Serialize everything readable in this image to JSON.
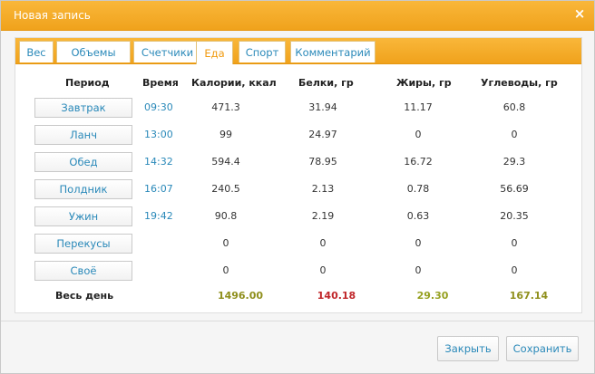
{
  "dialog": {
    "title": "Новая запись",
    "close_icon": "×"
  },
  "tabs": [
    {
      "label": "Вес",
      "active": false
    },
    {
      "label": "Объемы",
      "active": false
    },
    {
      "label": "Счетчики",
      "active": false
    },
    {
      "label": "Еда",
      "active": true
    },
    {
      "label": "Спорт",
      "active": false
    },
    {
      "label": "Комментарий",
      "active": false
    }
  ],
  "table": {
    "headers": [
      "Период",
      "Время",
      "Калории, ккал",
      "Белки, гр",
      "Жиры, гр",
      "Углеводы, гр"
    ],
    "rows": [
      {
        "period": "Завтрак",
        "time": "09:30",
        "calories": "471.3",
        "protein": "31.94",
        "fat": "11.17",
        "carbs": "60.8"
      },
      {
        "period": "Ланч",
        "time": "13:00",
        "calories": "99",
        "protein": "24.97",
        "fat": "0",
        "carbs": "0"
      },
      {
        "period": "Обед",
        "time": "14:32",
        "calories": "594.4",
        "protein": "78.95",
        "fat": "16.72",
        "carbs": "29.3"
      },
      {
        "period": "Полдник",
        "time": "16:07",
        "calories": "240.5",
        "protein": "2.13",
        "fat": "0.78",
        "carbs": "56.69"
      },
      {
        "period": "Ужин",
        "time": "19:42",
        "calories": "90.8",
        "protein": "2.19",
        "fat": "0.63",
        "carbs": "20.35"
      },
      {
        "period": "Перекусы",
        "time": "",
        "calories": "0",
        "protein": "0",
        "fat": "0",
        "carbs": "0"
      },
      {
        "period": "Своё",
        "time": "",
        "calories": "0",
        "protein": "0",
        "fat": "0",
        "carbs": "0"
      }
    ],
    "total": {
      "label": "Весь день",
      "calories": "1496.00",
      "protein": "140.18",
      "fat": "29.30",
      "carbs": "167.14"
    }
  },
  "buttons": {
    "close": "Закрыть",
    "save": "Сохранить"
  },
  "colors": {
    "accent": "#f0a21c",
    "link": "#2a89b9",
    "total_calories": "#8f8f1c",
    "total_protein": "#c0262a",
    "total_fat": "#96a020",
    "total_carbs": "#8f8f1c"
  }
}
